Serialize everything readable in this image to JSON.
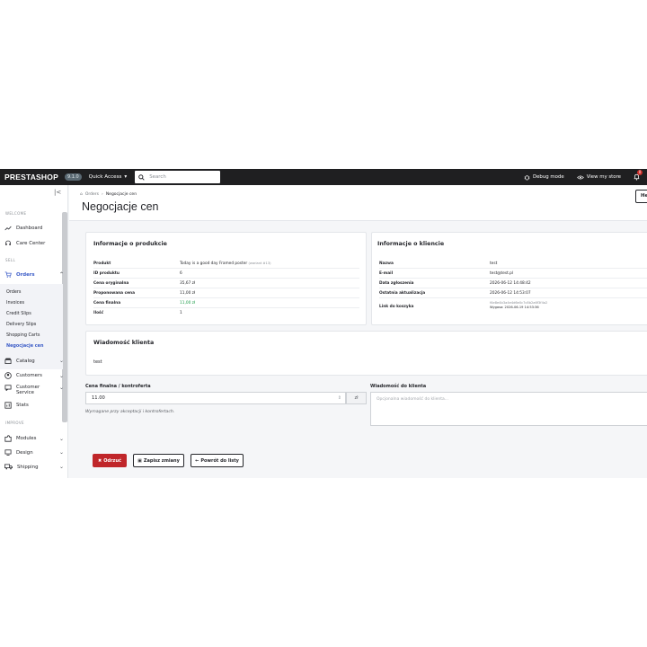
{
  "topbar": {
    "brand": "PRESTASHOP",
    "version": "9.1.0",
    "quick_access": "Quick Access",
    "search_placeholder": "Search",
    "debug_mode": "Debug mode",
    "view_store": "View my store",
    "notifications_count": "0"
  },
  "sidebar": {
    "welcome_label": "WELCOME",
    "dashboard": "Dashboard",
    "care_center": "Care Center",
    "sell_label": "SELL",
    "orders": "Orders",
    "orders_sub": [
      "Orders",
      "Invoices",
      "Credit Slips",
      "Delivery Slips",
      "Shopping Carts",
      "Negocjacje cen"
    ],
    "catalog": "Catalog",
    "customers": "Customers",
    "customer_service": "Customer Service",
    "stats": "Stats",
    "improve_label": "IMPROVE",
    "modules": "Modules",
    "design": "Design",
    "shipping": "Shipping"
  },
  "header": {
    "breadcrumb_parent": "Orders",
    "breadcrumb_current": "Negocjacje cen",
    "title": "Negocjacje cen",
    "help_label": "He"
  },
  "product_card": {
    "title": "Informacje o produkcie",
    "rows": [
      {
        "label": "Produkt",
        "value": "Today is a good day Framed poster",
        "extra": "(wariant #13)"
      },
      {
        "label": "ID produktu",
        "value": "6"
      },
      {
        "label": "Cena oryginalna",
        "value": "35,67 zł"
      },
      {
        "label": "Proponowana cena",
        "value": "11,00 zł"
      },
      {
        "label": "Cena finalna",
        "value": "11,00 zł"
      },
      {
        "label": "Ilość",
        "value": "1"
      }
    ]
  },
  "client_card": {
    "title": "Informacje o kliencie",
    "rows": [
      {
        "label": "Nazwa",
        "value": "test"
      },
      {
        "label": "E-mail",
        "value": "test@test.pl"
      },
      {
        "label": "Data zgłoszenia",
        "value": "2026-06-12 14:48:42"
      },
      {
        "label": "Ostatnia aktualizacja",
        "value": "2026-06-12 14:53:07"
      }
    ],
    "cart_link_label": "Link do koszyka",
    "cart_link_value": "f4e8e4b3a4e4d6e0c7c8b2a6f3f4a2",
    "cart_link_expiry": "Wygasa: 2026-06-19 14:53:36"
  },
  "message_card": {
    "title": "Wiadomość klienta",
    "text": "test"
  },
  "form": {
    "price_label": "Cena finalna / kontroferta",
    "price_value": "11.00",
    "currency_symbol": "zł",
    "hint": "Wymagane przy akceptacji i kontrofertach.",
    "message_label": "Wiadomość do klienta",
    "message_placeholder": "Opcjonalna wiadomość do klienta..."
  },
  "actions": {
    "reject": "Odrzuć",
    "save": "Zapisz zmiany",
    "back": "Powrót do listy"
  }
}
